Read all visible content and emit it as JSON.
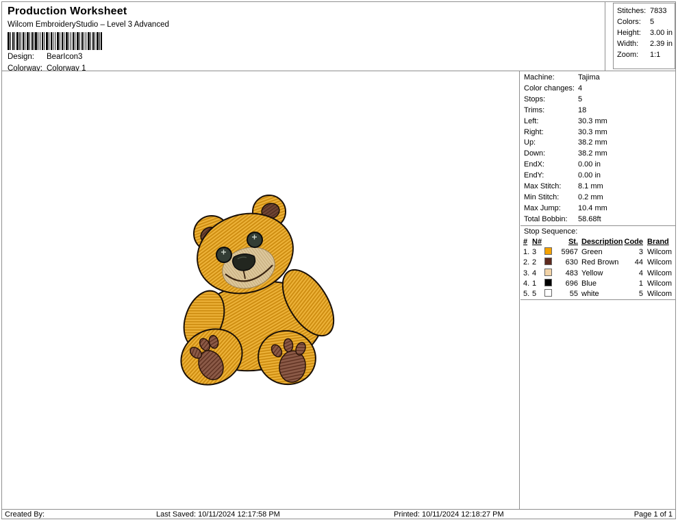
{
  "header": {
    "title": "Production Worksheet",
    "subtitle": "Wilcom EmbroideryStudio – Level 3 Advanced",
    "design_label": "Design:",
    "design_value": "BearIcon3",
    "colorway_label": "Colorway:",
    "colorway_value": "Colorway 1"
  },
  "stats": {
    "rows": [
      {
        "label": "Stitches:",
        "value": "7833"
      },
      {
        "label": "Colors:",
        "value": "5"
      },
      {
        "label": "Height:",
        "value": "3.00 in"
      },
      {
        "label": "Width:",
        "value": "2.39 in"
      },
      {
        "label": "Zoom:",
        "value": "1:1"
      }
    ]
  },
  "machine_info": {
    "rows": [
      {
        "label": "Machine:",
        "value": "Tajima"
      },
      {
        "label": "Color changes:",
        "value": "4"
      },
      {
        "label": "Stops:",
        "value": "5"
      },
      {
        "label": "Trims:",
        "value": "18"
      },
      {
        "label": "Left:",
        "value": "30.3 mm"
      },
      {
        "label": "Right:",
        "value": "30.3 mm"
      },
      {
        "label": "Up:",
        "value": "38.2 mm"
      },
      {
        "label": "Down:",
        "value": "38.2 mm"
      },
      {
        "label": "EndX:",
        "value": "0.00 in"
      },
      {
        "label": "EndY:",
        "value": "0.00 in"
      },
      {
        "label": "Max Stitch:",
        "value": "8.1 mm"
      },
      {
        "label": "Min Stitch:",
        "value": "0.2 mm"
      },
      {
        "label": "Max Jump:",
        "value": "10.4 mm"
      },
      {
        "label": "Total Bobbin:",
        "value": "58.68ft"
      }
    ]
  },
  "stop_sequence": {
    "title": "Stop Sequence:",
    "columns": {
      "num": "#",
      "n": "N#",
      "st": "St.",
      "desc": "Description",
      "code": "Code",
      "brand": "Brand"
    },
    "rows": [
      {
        "num": "1.",
        "n": "3",
        "swatch": "#F5A201",
        "st": "5967",
        "desc": "Green",
        "code": "3",
        "brand": "Wilcom"
      },
      {
        "num": "2.",
        "n": "2",
        "swatch": "#5E2B20",
        "st": "630",
        "desc": "Red Brown",
        "code": "44",
        "brand": "Wilcom"
      },
      {
        "num": "3.",
        "n": "4",
        "swatch": "#F2D3A7",
        "st": "483",
        "desc": "Yellow",
        "code": "4",
        "brand": "Wilcom"
      },
      {
        "num": "4.",
        "n": "1",
        "swatch": "#000000",
        "st": "696",
        "desc": "Blue",
        "code": "1",
        "brand": "Wilcom"
      },
      {
        "num": "5.",
        "n": "5",
        "swatch": "#FFFFFF",
        "st": "55",
        "desc": "white",
        "code": "5",
        "brand": "Wilcom"
      }
    ]
  },
  "design_preview": {
    "description": "Teddy bear embroidery design",
    "colors": {
      "gold": "#E2A21F",
      "gold_dark": "#C2820E",
      "gold_light": "#F3BE4F",
      "outline": "#1A1008",
      "inner_ear": "#6E4433",
      "muzzle": "#DCC79C",
      "paw_pad": "#8B5A47",
      "eye": "#333D35",
      "nose": "#22261F"
    }
  },
  "footer": {
    "created_by": "Created By:",
    "last_saved": "Last Saved: 10/11/2024 12:17:58 PM",
    "printed": "Printed: 10/11/2024 12:18:27 PM",
    "page": "Page 1 of 1"
  }
}
